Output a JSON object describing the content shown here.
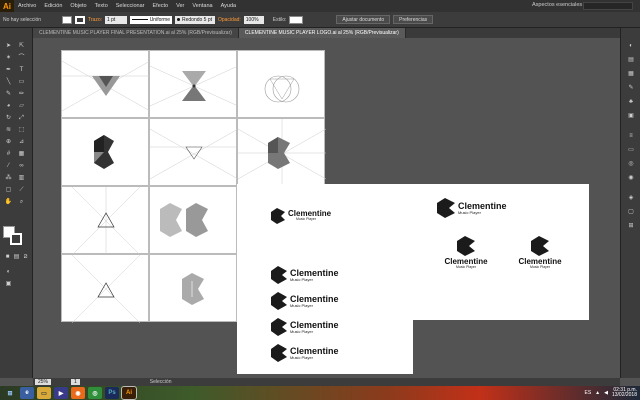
{
  "app": {
    "logo": "Ai",
    "workspace": "Aspectos esenciales"
  },
  "menu": [
    "Archivo",
    "Edición",
    "Objeto",
    "Texto",
    "Seleccionar",
    "Efecto",
    "Ver",
    "Ventana",
    "Ayuda"
  ],
  "control_bar": {
    "selection": "No hay selección",
    "stroke_label": "Trazo:",
    "stroke_weight": "1 pt",
    "profile": "Uniforme",
    "brush": "Redondo 5 pt",
    "opacity_label": "Opacidad:",
    "opacity_value": "100%",
    "style_label": "Estilo:",
    "doc_setup_button": "Ajustar documento",
    "prefs_button": "Preferencias"
  },
  "tabs": [
    {
      "label": "CLEMENTINE MUSIC PLAYER FINAL PRESENTATION.ai al 25% (RGB/Previsualizar)",
      "active": false
    },
    {
      "label": "CLEMENTINE MUSIC PLAYER LOGO.ai al 25% (RGB/Previsualizar)",
      "active": true
    }
  ],
  "logo": {
    "name": "Clementine",
    "tagline": "Music Player"
  },
  "statusbar": {
    "zoom": "25%",
    "page": "1",
    "tool": "Selección"
  },
  "taskbar": {
    "lang": "ES",
    "time": "02:31 p.m.",
    "date": "13/02/2018"
  },
  "colors": {
    "accent": "#ff9a00",
    "ui_dark": "#323232",
    "panel": "#3c3c3c",
    "pasteboard": "#535353"
  },
  "icons": {
    "tools": [
      "selection-icon",
      "direct-selection-icon",
      "magic-wand-icon",
      "lasso-icon",
      "pen-icon",
      "type-icon",
      "line-icon",
      "rectangle-icon",
      "paintbrush-icon",
      "pencil-icon",
      "blob-brush-icon",
      "eraser-icon",
      "rotate-icon",
      "scale-icon",
      "width-icon",
      "free-transform-icon",
      "shape-builder-icon",
      "perspective-icon",
      "mesh-icon",
      "gradient-icon",
      "eyedropper-icon",
      "blend-icon",
      "symbol-sprayer-icon",
      "graph-icon",
      "artboard-icon",
      "slice-icon",
      "hand-icon",
      "zoom-icon"
    ],
    "dock": [
      "color-icon",
      "color-guide-icon",
      "swatches-icon",
      "brushes-icon",
      "symbols-icon",
      "graphic-styles-icon",
      "stroke-icon",
      "gradient-panel-icon",
      "transparency-icon",
      "appearance-icon",
      "layers-icon",
      "artboards-icon",
      "align-icon"
    ]
  }
}
